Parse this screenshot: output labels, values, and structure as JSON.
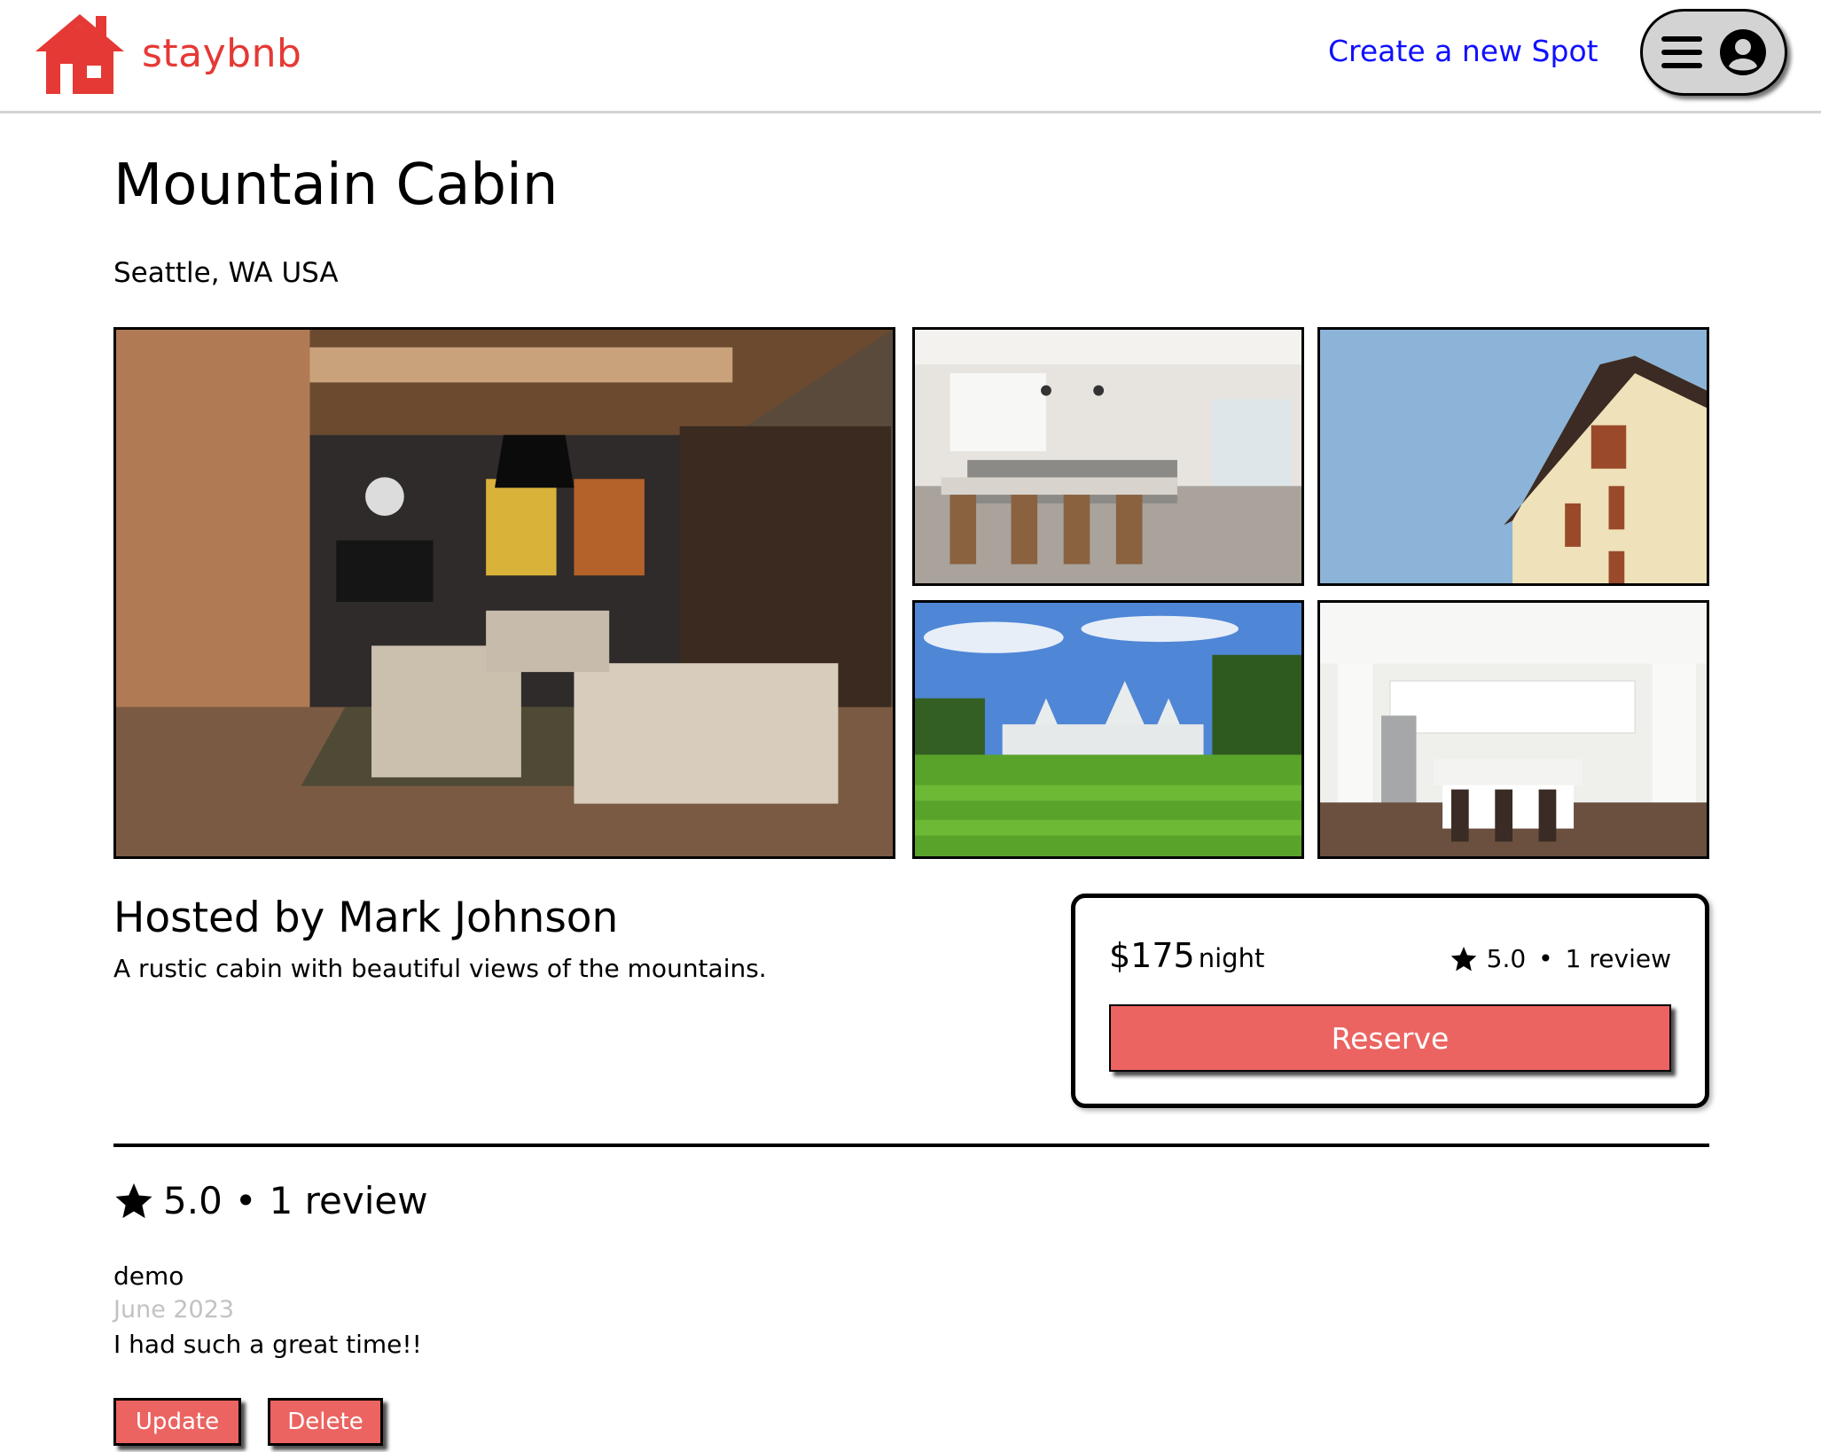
{
  "brand": {
    "name": "staybnb",
    "color": "#e53935"
  },
  "nav": {
    "create_spot": "Create a new Spot"
  },
  "spot": {
    "title": "Mountain Cabin",
    "location": "Seattle, WA USA",
    "host": "Hosted by Mark Johnson",
    "description": "A rustic cabin with beautiful views of the mountains.",
    "images": [
      "living-room",
      "kitchen-with-bar-stools",
      "house-gable-against-sky",
      "house-with-lawn",
      "white-kitchen-island"
    ]
  },
  "booking": {
    "price": "$175",
    "unit": "night",
    "rating": "5.0",
    "review_count": "1 review",
    "reserve_label": "Reserve"
  },
  "reviews": {
    "rating": "5.0",
    "count": "1 review",
    "items": [
      {
        "user": "demo",
        "date": "June 2023",
        "text": "I had such a great time!!"
      }
    ],
    "update_label": "Update",
    "delete_label": "Delete"
  },
  "colors": {
    "accent": "#eb6461",
    "link": "#1010ff",
    "muted": "#c2c2c2"
  }
}
